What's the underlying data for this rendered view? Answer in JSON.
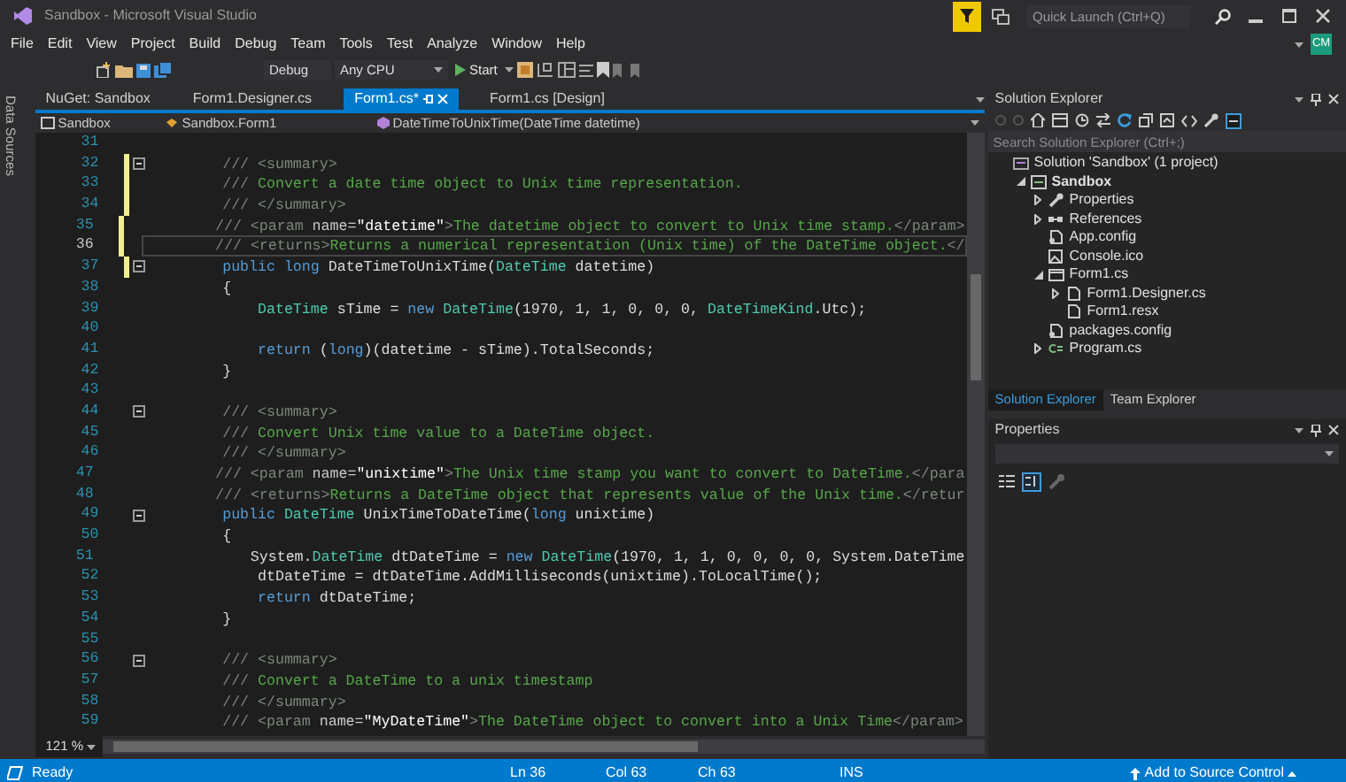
{
  "window": {
    "title": "Sandbox - Microsoft Visual Studio",
    "quick_launch": {
      "placeholder": "Quick Launch (Ctrl+Q)"
    },
    "account": "CM"
  },
  "menu": [
    "File",
    "Edit",
    "View",
    "Project",
    "Build",
    "Debug",
    "Team",
    "Tools",
    "Test",
    "Analyze",
    "Window",
    "Help"
  ],
  "toolbar": {
    "configuration": "Debug",
    "platform": "Any CPU",
    "start": "Start"
  },
  "side_tab": "Data Sources",
  "doc_tabs": [
    {
      "label": "NuGet: Sandbox",
      "selected": false
    },
    {
      "label": "Form1.Designer.cs",
      "selected": false
    },
    {
      "label": "Form1.cs*",
      "selected": true
    },
    {
      "label": "Form1.cs [Design]",
      "selected": false
    }
  ],
  "nav_bar": [
    "Sandbox",
    "Sandbox.Form1",
    "DateTimeToUnixTime(DateTime datetime)"
  ],
  "editor": {
    "zoom": "121 %",
    "lines": [
      {
        "number": "31",
        "current": false,
        "modified": false,
        "fold": false
      },
      {
        "number": "32",
        "current": false,
        "modified": true,
        "fold": true,
        "segments": [
          {
            "kind": "doc",
            "text": "        /// <summary>"
          }
        ]
      },
      {
        "number": "33",
        "current": false,
        "modified": true,
        "fold": false,
        "segments": [
          {
            "kind": "doc",
            "text": "        /// "
          },
          {
            "kind": "comment",
            "text": "Convert a date time object to Unix time representation."
          }
        ]
      },
      {
        "number": "34",
        "current": false,
        "modified": true,
        "fold": false,
        "segments": [
          {
            "kind": "doc",
            "text": "        /// </summary>"
          }
        ]
      },
      {
        "number": "35",
        "current": false,
        "modified": true,
        "fold": false,
        "segments": [
          {
            "kind": "doc",
            "text": "        /// <param "
          },
          {
            "kind": "attr",
            "text": "name="
          },
          {
            "kind": "value",
            "text": "\"datetime\""
          },
          {
            "kind": "doc",
            "text": ">"
          },
          {
            "kind": "comment",
            "text": "The datetime object to convert to Unix time stamp."
          },
          {
            "kind": "doc",
            "text": "</param>"
          }
        ]
      },
      {
        "number": "36",
        "current": true,
        "modified": true,
        "fold": false,
        "segments": [
          {
            "kind": "doc",
            "text": "        /// <returns>"
          },
          {
            "kind": "comment",
            "text": "Returns a numerical representation (Unix time) of the DateTime object."
          },
          {
            "kind": "doc",
            "text": "</"
          }
        ]
      },
      {
        "number": "37",
        "current": false,
        "modified": true,
        "fold": true,
        "segments": [
          {
            "kind": "keyword",
            "text": "        public long "
          },
          {
            "kind": "plain",
            "text": "DateTimeToUnixTime("
          },
          {
            "kind": "type",
            "text": "DateTime"
          },
          {
            "kind": "plain",
            "text": " datetime)"
          }
        ]
      },
      {
        "number": "38",
        "current": false,
        "modified": false,
        "fold": false,
        "segments": [
          {
            "kind": "plain",
            "text": "        {"
          }
        ]
      },
      {
        "number": "39",
        "current": false,
        "modified": false,
        "fold": false,
        "segments": [
          {
            "kind": "type",
            "text": "            DateTime"
          },
          {
            "kind": "plain",
            "text": " sTime = "
          },
          {
            "kind": "keyword",
            "text": "new "
          },
          {
            "kind": "type",
            "text": "DateTime"
          },
          {
            "kind": "plain",
            "text": "(1970, 1, 1, 0, 0, 0, "
          },
          {
            "kind": "type",
            "text": "DateTimeKind"
          },
          {
            "kind": "plain",
            "text": ".Utc);"
          }
        ]
      },
      {
        "number": "40",
        "current": false,
        "modified": false,
        "fold": false
      },
      {
        "number": "41",
        "current": false,
        "modified": false,
        "fold": false,
        "segments": [
          {
            "kind": "keyword",
            "text": "            return "
          },
          {
            "kind": "plain",
            "text": "("
          },
          {
            "kind": "keyword",
            "text": "long"
          },
          {
            "kind": "plain",
            "text": ")(datetime - sTime).TotalSeconds;"
          }
        ]
      },
      {
        "number": "42",
        "current": false,
        "modified": false,
        "fold": false,
        "segments": [
          {
            "kind": "plain",
            "text": "        }"
          }
        ]
      },
      {
        "number": "43",
        "current": false,
        "modified": false,
        "fold": false
      },
      {
        "number": "44",
        "current": false,
        "modified": false,
        "fold": true,
        "segments": [
          {
            "kind": "doc",
            "text": "        /// <summary>"
          }
        ]
      },
      {
        "number": "45",
        "current": false,
        "modified": false,
        "fold": false,
        "segments": [
          {
            "kind": "doc",
            "text": "        /// "
          },
          {
            "kind": "comment",
            "text": "Convert Unix time value to a DateTime object."
          }
        ]
      },
      {
        "number": "46",
        "current": false,
        "modified": false,
        "fold": false,
        "segments": [
          {
            "kind": "doc",
            "text": "        /// </summary>"
          }
        ]
      },
      {
        "number": "47",
        "current": false,
        "modified": false,
        "fold": false,
        "segments": [
          {
            "kind": "doc",
            "text": "        /// <param "
          },
          {
            "kind": "attr",
            "text": "name="
          },
          {
            "kind": "value",
            "text": "\"unixtime\""
          },
          {
            "kind": "doc",
            "text": ">"
          },
          {
            "kind": "comment",
            "text": "The Unix time stamp you want to convert to DateTime."
          },
          {
            "kind": "doc",
            "text": "</para"
          }
        ]
      },
      {
        "number": "48",
        "current": false,
        "modified": false,
        "fold": false,
        "segments": [
          {
            "kind": "doc",
            "text": "        /// <returns>"
          },
          {
            "kind": "comment",
            "text": "Returns a DateTime object that represents value of the Unix time."
          },
          {
            "kind": "doc",
            "text": "</retur"
          }
        ]
      },
      {
        "number": "49",
        "current": false,
        "modified": false,
        "fold": true,
        "segments": [
          {
            "kind": "keyword",
            "text": "        public "
          },
          {
            "kind": "type",
            "text": "DateTime"
          },
          {
            "kind": "plain",
            "text": " UnixTimeToDateTime("
          },
          {
            "kind": "keyword",
            "text": "long"
          },
          {
            "kind": "plain",
            "text": " unixtime)"
          }
        ]
      },
      {
        "number": "50",
        "current": false,
        "modified": false,
        "fold": false,
        "segments": [
          {
            "kind": "plain",
            "text": "        {"
          }
        ]
      },
      {
        "number": "51",
        "current": false,
        "modified": false,
        "fold": false,
        "segments": [
          {
            "kind": "plain",
            "text": "            System."
          },
          {
            "kind": "type",
            "text": "DateTime"
          },
          {
            "kind": "plain",
            "text": " dtDateTime = "
          },
          {
            "kind": "keyword",
            "text": "new "
          },
          {
            "kind": "type",
            "text": "DateTime"
          },
          {
            "kind": "plain",
            "text": "(1970, 1, 1, 0, 0, 0, 0, System.DateTime"
          }
        ]
      },
      {
        "number": "52",
        "current": false,
        "modified": false,
        "fold": false,
        "segments": [
          {
            "kind": "plain",
            "text": "            dtDateTime = dtDateTime.AddMilliseconds(unixtime).ToLocalTime();"
          }
        ]
      },
      {
        "number": "53",
        "current": false,
        "modified": false,
        "fold": false,
        "segments": [
          {
            "kind": "keyword",
            "text": "            return"
          },
          {
            "kind": "plain",
            "text": " dtDateTime;"
          }
        ]
      },
      {
        "number": "54",
        "current": false,
        "modified": false,
        "fold": false,
        "segments": [
          {
            "kind": "plain",
            "text": "        }"
          }
        ]
      },
      {
        "number": "55",
        "current": false,
        "modified": false,
        "fold": false
      },
      {
        "number": "56",
        "current": false,
        "modified": false,
        "fold": true,
        "segments": [
          {
            "kind": "doc",
            "text": "        /// <summary>"
          }
        ]
      },
      {
        "number": "57",
        "current": false,
        "modified": false,
        "fold": false,
        "segments": [
          {
            "kind": "doc",
            "text": "        /// "
          },
          {
            "kind": "comment",
            "text": "Convert a DateTime to a unix timestamp"
          }
        ]
      },
      {
        "number": "58",
        "current": false,
        "modified": false,
        "fold": false,
        "segments": [
          {
            "kind": "doc",
            "text": "        /// </summary>"
          }
        ]
      },
      {
        "number": "59",
        "current": false,
        "modified": false,
        "fold": false,
        "segments": [
          {
            "kind": "doc",
            "text": "        /// <param "
          },
          {
            "kind": "attr",
            "text": "name="
          },
          {
            "kind": "value",
            "text": "\"MyDateTime\""
          },
          {
            "kind": "doc",
            "text": ">"
          },
          {
            "kind": "comment",
            "text": "The DateTime object to convert into a Unix Time"
          },
          {
            "kind": "doc",
            "text": "</param>"
          }
        ]
      }
    ]
  },
  "solution_explorer": {
    "title": "Solution Explorer",
    "search": {
      "placeholder": "Search Solution Explorer (Ctrl+;)"
    },
    "tree": [
      {
        "label": "Solution 'Sandbox' (1 project)",
        "kind": "solution",
        "children": [
          {
            "label": "Sandbox",
            "kind": "project",
            "expanded": true,
            "children": [
              {
                "label": "Properties",
                "kind": "properties",
                "expanded": false
              },
              {
                "label": "References",
                "kind": "references",
                "expanded": false
              },
              {
                "label": "App.config",
                "kind": "config"
              },
              {
                "label": "Console.ico",
                "kind": "image"
              },
              {
                "label": "Form1.cs",
                "kind": "form",
                "expanded": true,
                "children": [
                  {
                    "label": "Form1.Designer.cs",
                    "kind": "file",
                    "expanded": false
                  },
                  {
                    "label": "Form1.resx",
                    "kind": "file"
                  }
                ]
              },
              {
                "label": "packages.config",
                "kind": "config"
              },
              {
                "label": "Program.cs",
                "kind": "csharp",
                "expanded": false
              }
            ]
          }
        ]
      }
    ],
    "tabs": [
      {
        "label": "Solution Explorer",
        "selected": true
      },
      {
        "label": "Team Explorer",
        "selected": false
      }
    ]
  },
  "properties": {
    "title": "Properties"
  },
  "status_bar": {
    "message": "Ready",
    "line": "Ln 36",
    "col": "Col 63",
    "ch": "Ch 63",
    "mode": "INS",
    "source_control": "Add to Source Control"
  }
}
